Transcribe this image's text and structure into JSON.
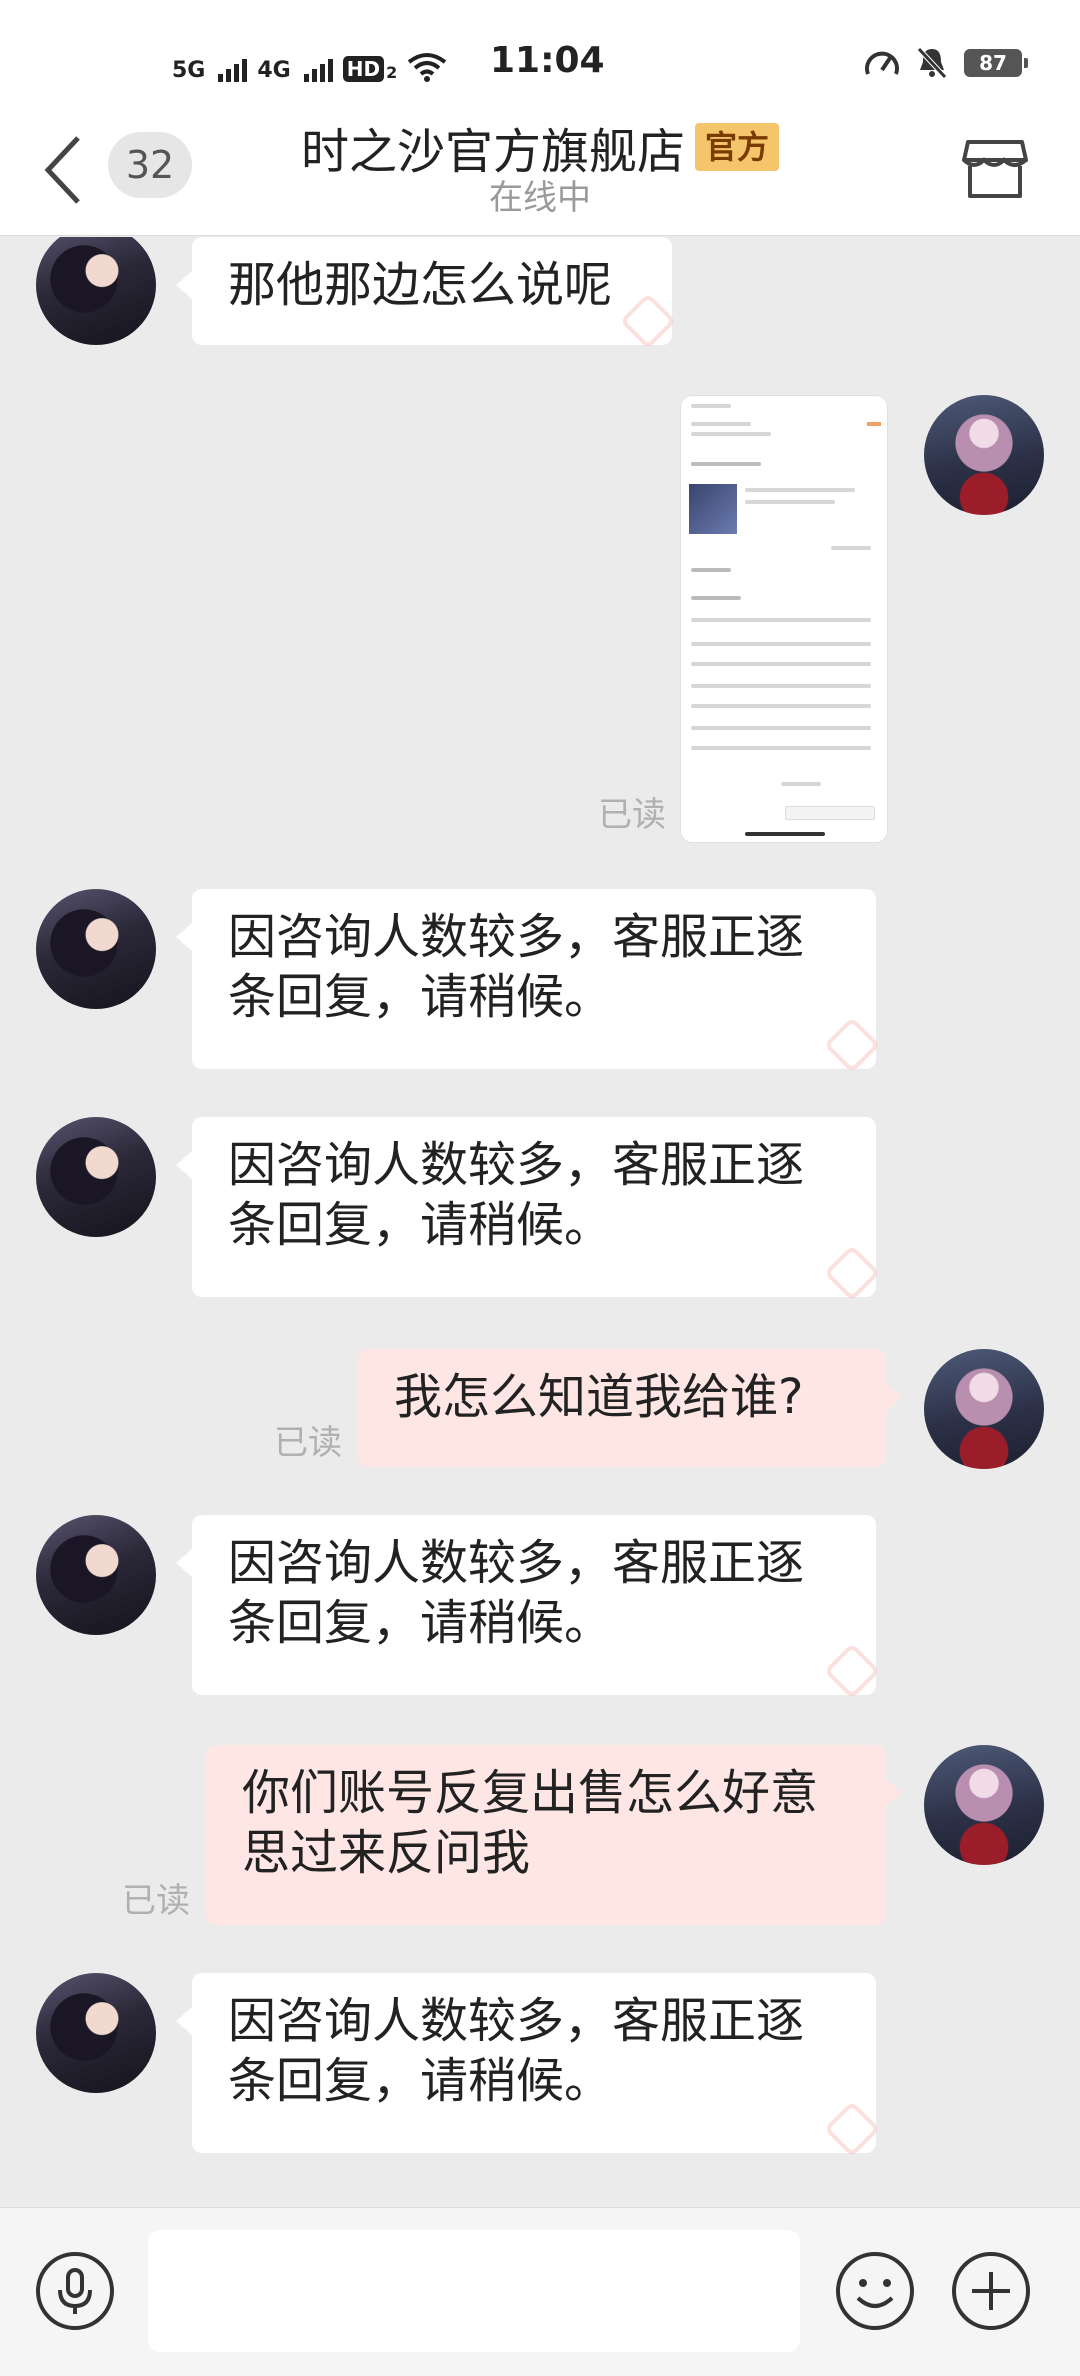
{
  "status_bar": {
    "network1": "5G",
    "network2": "4G",
    "hd": "HD",
    "hd_sub": "2",
    "time": "11:04",
    "battery": "87"
  },
  "header": {
    "back_icon": "chevron-left-icon",
    "unread_count": "32",
    "title": "时之沙官方旗舰店",
    "badge": "官方",
    "online_status": "在线中",
    "store_icon": "store-icon"
  },
  "messages": [
    {
      "side": "in",
      "type": "text",
      "text": "那他那边怎么说呢"
    },
    {
      "side": "out",
      "type": "image",
      "read": "已读"
    },
    {
      "side": "in",
      "type": "text",
      "text": "因咨询人数较多，客服正逐条回复，请稍候。"
    },
    {
      "side": "in",
      "type": "text",
      "text": "因咨询人数较多，客服正逐条回复，请稍候。"
    },
    {
      "side": "out",
      "type": "text",
      "text": "我怎么知道我给谁?",
      "read": "已读"
    },
    {
      "side": "in",
      "type": "text",
      "text": "因咨询人数较多，客服正逐条回复，请稍候。"
    },
    {
      "side": "out",
      "type": "text",
      "text": "你们账号反复出售怎么好意思过来反问我",
      "read": "已读"
    },
    {
      "side": "in",
      "type": "text",
      "text": "因咨询人数较多，客服正逐条回复，请稍候。"
    }
  ],
  "input_bar": {
    "voice_icon": "microphone-icon",
    "emoji_icon": "emoji-icon",
    "plus_icon": "plus-icon",
    "input_value": ""
  },
  "colors": {
    "chat_background": "#ebebeb",
    "incoming_bubble": "#ffffff",
    "outgoing_bubble": "#fde6e4",
    "official_badge": "#f4c56b",
    "read_text": "#b0b0b0"
  }
}
